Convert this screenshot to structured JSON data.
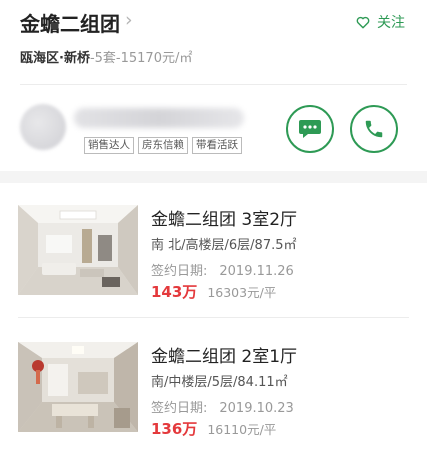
{
  "header": {
    "title": "金蟾二组团",
    "follow_label": "关注",
    "district": "瓯海区·新桥",
    "stats": "-5套-15170元/㎡"
  },
  "agent": {
    "tags": [
      "销售达人",
      "房东信赖",
      "带看活跃"
    ]
  },
  "listings": [
    {
      "title": "金蟾二组团 3室2厅",
      "detail": "南 北/高楼层/6层/87.5㎡",
      "date_label": "签约日期:",
      "date": "2019.11.26",
      "total_price": "143万",
      "unit_price": "16303元/平"
    },
    {
      "title": "金蟾二组团 2室1厅",
      "detail": "南/中楼层/5层/84.11㎡",
      "date_label": "签约日期:",
      "date": "2019.10.23",
      "total_price": "136万",
      "unit_price": "16110元/平"
    }
  ],
  "colors": {
    "accent": "#2e9a55",
    "price": "#e4393c",
    "muted": "#999999",
    "divider": "#f4f4f4"
  },
  "icons": {
    "follow": "heart-outline-icon",
    "chat": "chat-bubble-icon",
    "phone": "phone-icon",
    "title_chevron": "chevron-right-icon"
  }
}
